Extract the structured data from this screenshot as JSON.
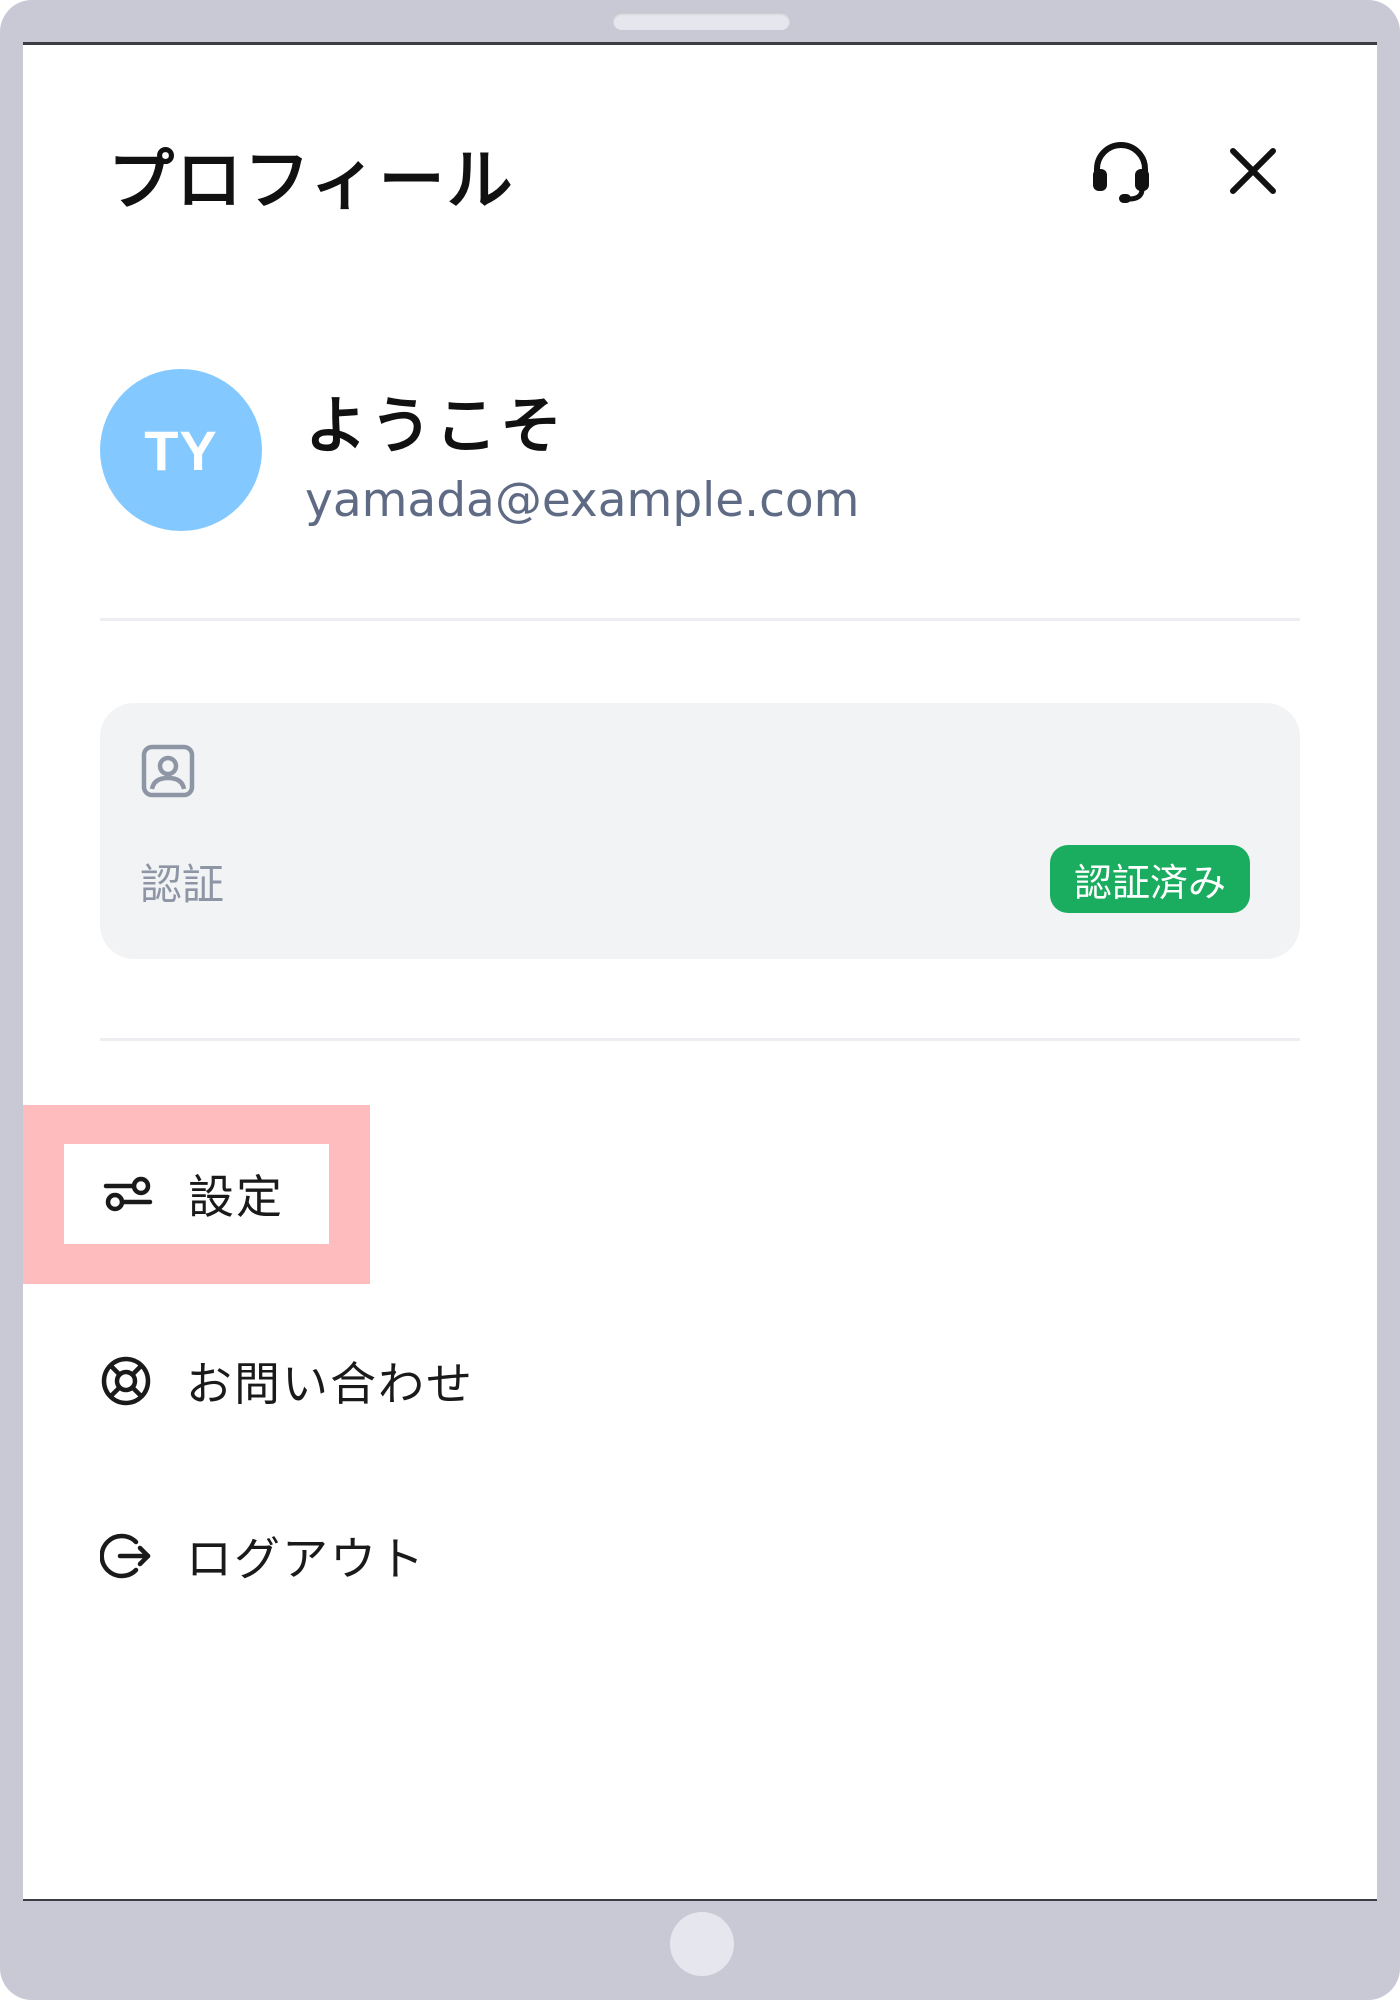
{
  "header": {
    "title": "プロフィール",
    "support_icon": "headset-icon",
    "close_icon": "close-icon"
  },
  "user": {
    "initials": "TY",
    "greeting": "ようこそ",
    "email": "yamada@example.com",
    "avatar_color": "#83c9ff"
  },
  "verification": {
    "icon": "id-badge-icon",
    "label": "認証",
    "status": "認証済み",
    "status_color": "#1bad5f"
  },
  "menu": {
    "items": [
      {
        "label": "設定",
        "icon": "sliders-icon",
        "highlighted": true
      },
      {
        "label": "お問い合わせ",
        "icon": "lifebuoy-icon"
      },
      {
        "label": "ログアウト",
        "icon": "logout-icon"
      }
    ]
  },
  "colors": {
    "highlight": "#ffbcbe",
    "device_frame": "#c8c9d4",
    "card_bg": "#f2f3f5"
  }
}
